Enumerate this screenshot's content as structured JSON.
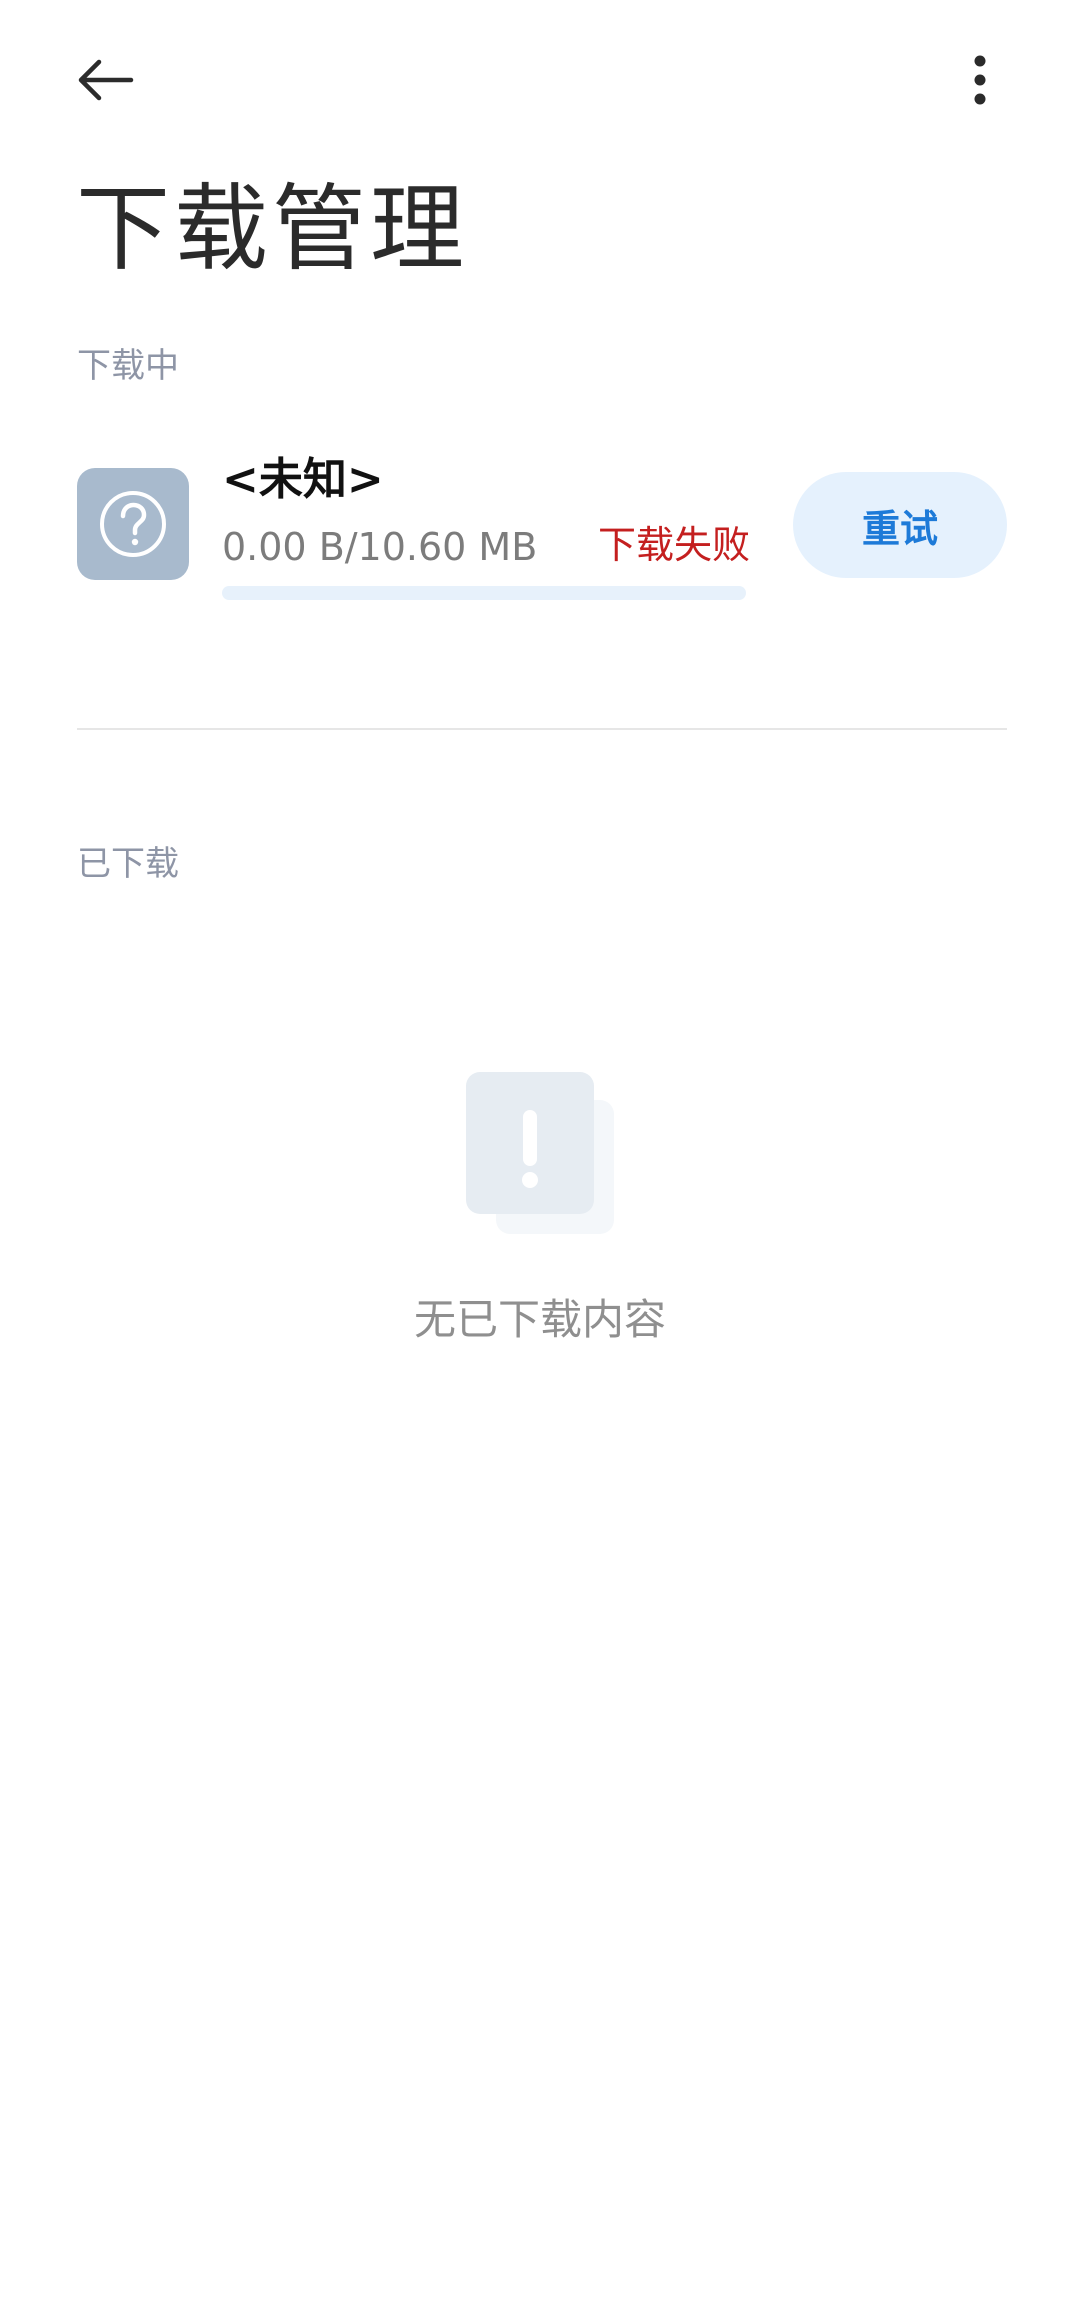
{
  "header": {
    "back_icon": "arrow-left-icon",
    "more_icon": "more-vertical-icon",
    "title": "下载管理"
  },
  "downloading_section": {
    "label": "下载中",
    "items": [
      {
        "icon": "question-file-icon",
        "name": "<未知>",
        "size": "0.00 B/10.60 MB",
        "status": "下载失败",
        "progress": 0,
        "retry_label": "重试"
      }
    ]
  },
  "downloaded_section": {
    "label": "已下载",
    "empty_icon": "empty-warning-icon",
    "empty_text": "无已下载内容"
  },
  "colors": {
    "accent": "#1d7ad8",
    "error": "#c41f1f",
    "section_label": "#8e95a6"
  }
}
